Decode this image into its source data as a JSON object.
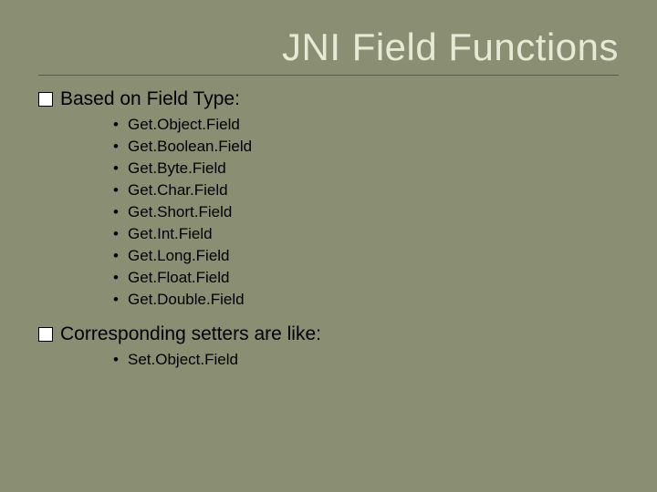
{
  "title": "JNI Field Functions",
  "section1": {
    "heading": "Based on Field Type:",
    "items": [
      "Get.Object.Field",
      "Get.Boolean.Field",
      "Get.Byte.Field",
      "Get.Char.Field",
      "Get.Short.Field",
      "Get.Int.Field",
      "Get.Long.Field",
      "Get.Float.Field",
      "Get.Double.Field"
    ]
  },
  "section2": {
    "heading": "Corresponding setters are like:",
    "items": [
      "Set.Object.Field"
    ]
  }
}
